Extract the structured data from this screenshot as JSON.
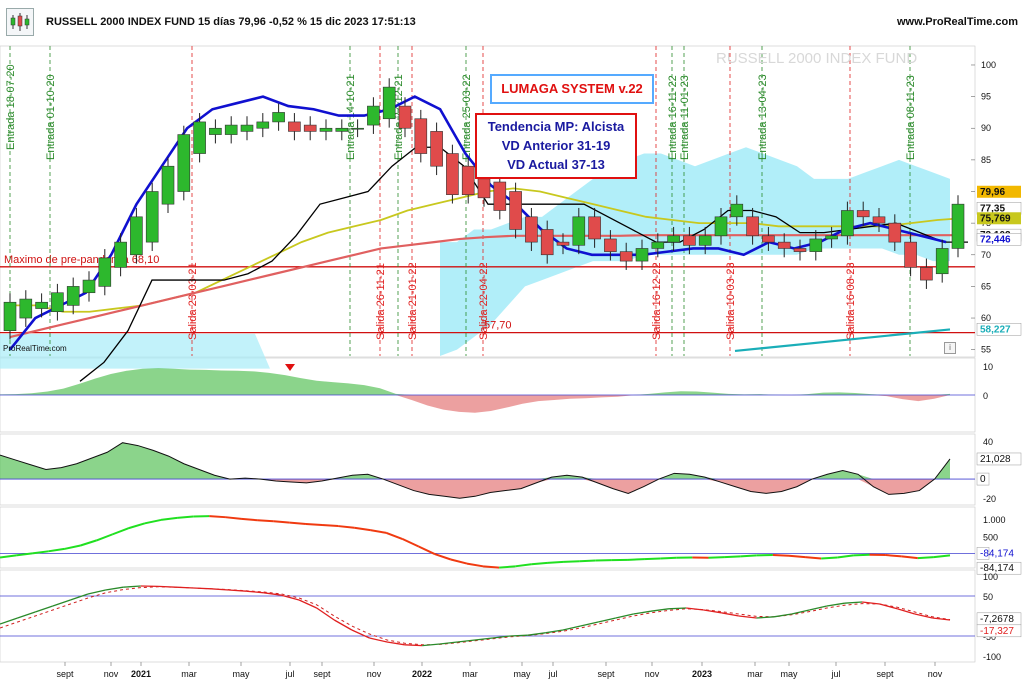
{
  "header": {
    "title": "RUSSELL 2000 INDEX FUND 15 días 79,96 -0,52 % 15 dic 2023 17:51:13",
    "site": "www.ProRealTime.com",
    "watermark": "RUSSELL 2000 INDEX FUND",
    "footer_brand": "ProRealTime.com",
    "info_glyph": "i"
  },
  "annotations": {
    "lumaga": "LUMAGA SYSTEM v.22",
    "trend_lines": [
      "Tendencia MP: Alcista",
      "VD Anterior 31-19",
      "VD Actual 37-13"
    ],
    "prepandemic": "Maximo de pre-pandemia 68,10",
    "level_label": "57,70"
  },
  "colors": {
    "up": "#2db82d",
    "down": "#e04b4b",
    "fast_ma": "#1010d0",
    "black_line": "#000000",
    "yellow_ma": "#c8c81e",
    "salmon_ma": "#e06060",
    "cloud": "#a8ecf8",
    "teal_line": "#1aaeb8",
    "red_level": "#d01010",
    "signal_green": "#2a8a2a",
    "signal_red": "#e02020"
  },
  "chart_data": [
    {
      "type": "candlestick",
      "title": "RUSSELL 2000 INDEX FUND",
      "period": "15 días",
      "last": 79.96,
      "change_pct": -0.52,
      "ylim": [
        54,
        103
      ],
      "y_ticks": [
        55,
        60,
        65,
        70,
        75,
        80,
        85,
        90,
        95,
        100
      ],
      "candles": [
        {
          "o": 58,
          "c": 62.5
        },
        {
          "o": 60,
          "c": 63
        },
        {
          "o": 61.5,
          "c": 62.5
        },
        {
          "o": 61,
          "c": 64
        },
        {
          "o": 62,
          "c": 65
        },
        {
          "o": 64,
          "c": 66
        },
        {
          "o": 65,
          "c": 69.5
        },
        {
          "o": 68,
          "c": 72
        },
        {
          "o": 70,
          "c": 76
        },
        {
          "o": 72,
          "c": 80
        },
        {
          "o": 78,
          "c": 84
        },
        {
          "o": 80,
          "c": 89
        },
        {
          "o": 86,
          "c": 91
        },
        {
          "o": 89,
          "c": 90
        },
        {
          "o": 89,
          "c": 90.5
        },
        {
          "o": 89.5,
          "c": 90.5
        },
        {
          "o": 90,
          "c": 91
        },
        {
          "o": 91,
          "c": 92.5
        },
        {
          "o": 91,
          "c": 89.5
        },
        {
          "o": 90.5,
          "c": 89.5
        },
        {
          "o": 89.5,
          "c": 90
        },
        {
          "o": 89.5,
          "c": 90
        },
        {
          "o": 90,
          "c": 90
        },
        {
          "o": 90.5,
          "c": 93.5
        },
        {
          "o": 91.5,
          "c": 96.5
        },
        {
          "o": 93.5,
          "c": 90
        },
        {
          "o": 91.5,
          "c": 86
        },
        {
          "o": 89.5,
          "c": 84
        },
        {
          "o": 86,
          "c": 79.5
        },
        {
          "o": 84,
          "c": 79.5
        },
        {
          "o": 82,
          "c": 79
        },
        {
          "o": 81.5,
          "c": 77
        },
        {
          "o": 80,
          "c": 74
        },
        {
          "o": 76,
          "c": 72
        },
        {
          "o": 74,
          "c": 70
        },
        {
          "o": 72,
          "c": 71.5
        },
        {
          "o": 71.5,
          "c": 76
        },
        {
          "o": 76,
          "c": 72.5
        },
        {
          "o": 72.5,
          "c": 70.5
        },
        {
          "o": 70.5,
          "c": 69
        },
        {
          "o": 69,
          "c": 71
        },
        {
          "o": 71,
          "c": 72
        },
        {
          "o": 72,
          "c": 73
        },
        {
          "o": 73,
          "c": 71.5
        },
        {
          "o": 71.5,
          "c": 73
        },
        {
          "o": 73,
          "c": 76
        },
        {
          "o": 76,
          "c": 78
        },
        {
          "o": 76,
          "c": 73
        },
        {
          "o": 73,
          "c": 72
        },
        {
          "o": 72,
          "c": 71
        },
        {
          "o": 71,
          "c": 70.5
        },
        {
          "o": 70.5,
          "c": 72.5
        },
        {
          "o": 72.5,
          "c": 73
        },
        {
          "o": 73,
          "c": 77
        },
        {
          "o": 77,
          "c": 76
        },
        {
          "o": 76,
          "c": 75
        },
        {
          "o": 75,
          "c": 72
        },
        {
          "o": 72,
          "c": 68
        },
        {
          "o": 68,
          "c": 66
        },
        {
          "o": 67,
          "c": 71
        },
        {
          "o": 71,
          "c": 78
        }
      ],
      "last_values": {
        "price": 79.96,
        "level_77": 77.35,
        "yellow_ma": 75.769,
        "salmon_ma": 73.102,
        "fast_ma": 72.446,
        "teal": 58.227
      },
      "signals": [
        {
          "label": "Entrada 18-07-20",
          "type": "buy"
        },
        {
          "label": "Entrada 01-10-20",
          "type": "buy"
        },
        {
          "label": "Salida 23-03-21",
          "type": "sell"
        },
        {
          "label": "Entrada 14-10-21",
          "type": "buy"
        },
        {
          "label": "Salida 26-11-21",
          "type": "sell"
        },
        {
          "label": "Entrada 27-12-21",
          "type": "buy"
        },
        {
          "label": "Salida 21-01-22",
          "type": "sell"
        },
        {
          "label": "Entrada 25-03-22",
          "type": "buy"
        },
        {
          "label": "Salida 22-04-22",
          "type": "sell"
        },
        {
          "label": "Salida 16-12-22",
          "type": "sell"
        },
        {
          "label": "Entrada 11-01-23",
          "type": "buy"
        },
        {
          "label": "Entrada 16-11-22",
          "type": "buy"
        },
        {
          "label": "Salida 10-03-23",
          "type": "sell"
        },
        {
          "label": "Entrada 13-04-23",
          "type": "buy"
        },
        {
          "label": "Salida 16-08-23",
          "type": "sell"
        },
        {
          "label": "Entrada 08-11-23",
          "type": "buy"
        }
      ],
      "horizontal_levels": [
        {
          "value": 68.1,
          "label": "Maximo de pre-pandemia 68,10"
        },
        {
          "value": 57.7,
          "label": "57,70"
        }
      ]
    },
    {
      "type": "area",
      "name": "oscillator-1",
      "ylim": [
        -12,
        12
      ],
      "y_ticks": [
        10,
        0
      ],
      "values": [
        0.2,
        0.3,
        0.6,
        1.2,
        2.2,
        3.8,
        5.6,
        7.2,
        8.3,
        9.0,
        9.2,
        9.0,
        8.7,
        8.6,
        8.4,
        8.3,
        8.1,
        7.6,
        6.8,
        5.8,
        4.9,
        4.4,
        4.0,
        3.4,
        2.3,
        0.4,
        -1.7,
        -3.6,
        -5.0,
        -5.8,
        -6.1,
        -5.5,
        -4.3,
        -3.0,
        -2.1,
        -1.7,
        -1.3,
        -1.1,
        -0.8,
        -0.6,
        -0.1,
        0.4,
        0.9,
        1.3,
        1.2,
        0.8,
        0.4,
        0.2,
        0.3,
        0.1,
        -0.1,
        0.3,
        0.8,
        0.9,
        0.7,
        0.3,
        -0.4,
        -1.4,
        -2.1,
        -1.3,
        0.4
      ]
    },
    {
      "type": "area",
      "name": "oscillator-2",
      "last": 21.028,
      "ylim": [
        -25,
        45
      ],
      "y_ticks": [
        40,
        0
      ],
      "values": [
        25,
        20,
        15,
        10,
        12,
        16,
        22,
        28,
        38,
        35,
        30,
        24,
        16,
        10,
        4,
        0,
        1,
        0,
        -2,
        -3,
        -4,
        -2,
        1,
        4,
        5,
        0,
        -6,
        -12,
        -16,
        -18,
        -20,
        -18,
        -14,
        -12,
        -10,
        -4,
        2,
        4,
        2,
        -4,
        -10,
        -15,
        -8,
        0,
        6,
        5,
        2,
        -3,
        -8,
        -13,
        -15,
        -13,
        -8,
        0,
        5,
        9,
        5,
        -8,
        -16,
        -15,
        -12,
        0,
        21
      ]
    },
    {
      "type": "line",
      "name": "oscillator-3",
      "last": -84.174,
      "ylim": [
        -400,
        1300
      ],
      "y_ticks": [
        1000,
        500,
        0
      ],
      "values": [
        -120,
        -60,
        0,
        60,
        130,
        230,
        380,
        560,
        740,
        880,
        980,
        1040,
        1080,
        1090,
        1060,
        1010,
        970,
        940,
        900,
        860,
        830,
        800,
        750,
        680,
        600,
        420,
        200,
        -20,
        -180,
        -300,
        -380,
        -420,
        -380,
        -320,
        -280,
        -250,
        -230,
        -210,
        -200,
        -190,
        -170,
        -150,
        -130,
        -120,
        -130,
        -110,
        -90,
        -60,
        -50,
        -70,
        -110,
        -150,
        -120,
        -60,
        -40,
        -50,
        -90,
        -140,
        -110,
        -60
      ]
    },
    {
      "type": "line",
      "name": "oscillator-4",
      "last_values": [
        -7.2678,
        -17.327
      ],
      "ylim": [
        -110,
        110
      ],
      "y_ticks": [
        100,
        50,
        -50,
        -100
      ],
      "values": [
        -20,
        -5,
        10,
        25,
        40,
        55,
        65,
        72,
        75,
        74,
        72,
        70,
        68,
        65,
        62,
        58,
        52,
        40,
        20,
        -10,
        -35,
        -55,
        -65,
        -72,
        -74,
        -70,
        -65,
        -60,
        -55,
        -50,
        -48,
        -42,
        -35,
        -25,
        -15,
        -5,
        5,
        12,
        18,
        20,
        15,
        8,
        0,
        -5,
        -2,
        5,
        15,
        25,
        32,
        35,
        30,
        18,
        5,
        -5,
        -10
      ],
      "signal_values": [
        -30,
        -15,
        0,
        15,
        30,
        45,
        58,
        66,
        71,
        73,
        72,
        70,
        68,
        66,
        63,
        60,
        55,
        45,
        28,
        0,
        -25,
        -45,
        -60,
        -68,
        -72,
        -71,
        -67,
        -62,
        -57,
        -52,
        -49,
        -44,
        -38,
        -30,
        -20,
        -10,
        0,
        8,
        14,
        18,
        16,
        11,
        5,
        -1,
        -2,
        3,
        11,
        20,
        27,
        31,
        30,
        22,
        10,
        -2,
        -9
      ]
    }
  ],
  "axis": {
    "labels": [
      "sept",
      "nov",
      "2021",
      "mar",
      "may",
      "jul",
      "sept",
      "nov",
      "2022",
      "mar",
      "may",
      "jul",
      "sept",
      "nov",
      "2023",
      "mar",
      "may",
      "jul",
      "sept",
      "nov"
    ],
    "bold": [
      "2021",
      "2022",
      "2023"
    ]
  },
  "price_axis_labels": [
    "100",
    "95",
    "90",
    "85",
    "80",
    "75",
    "70",
    "65",
    "60",
    "55"
  ],
  "osc_axis_labels": {
    "p1": [
      "10",
      "0"
    ],
    "p2": [
      "40",
      "0",
      "-20"
    ],
    "p3": [
      "1.000",
      "500",
      "0"
    ],
    "p4": [
      "100",
      "50",
      "-50",
      "-100"
    ]
  },
  "value_badges": [
    "79,96",
    "77,35",
    "75,769",
    "73,102",
    "72,446",
    "58,227",
    "0",
    "21,028",
    "0",
    "-84,174",
    "-7,2678",
    "-17,327"
  ]
}
